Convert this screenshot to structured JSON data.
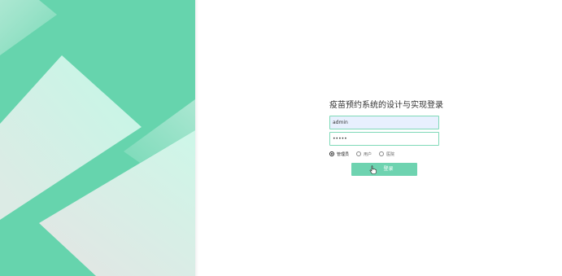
{
  "colors": {
    "brand_green": "#66d4ad",
    "button_green": "#6ed3b0",
    "input_border": "#7fd9b8",
    "autofill_bg": "#e8f0fe"
  },
  "login": {
    "title": "疫苗预约系统的设计与实现登录",
    "username_value": "admin",
    "password_value": "•••••",
    "roles": [
      {
        "label": "管理员",
        "checked": true
      },
      {
        "label": "用户",
        "checked": false
      },
      {
        "label": "医院",
        "checked": false
      }
    ],
    "submit_label": "登录"
  },
  "icons": {
    "cursor": "hand-pointer-icon",
    "radio_checked": "radio-checked-icon",
    "radio_unchecked": "radio-unchecked-icon"
  }
}
